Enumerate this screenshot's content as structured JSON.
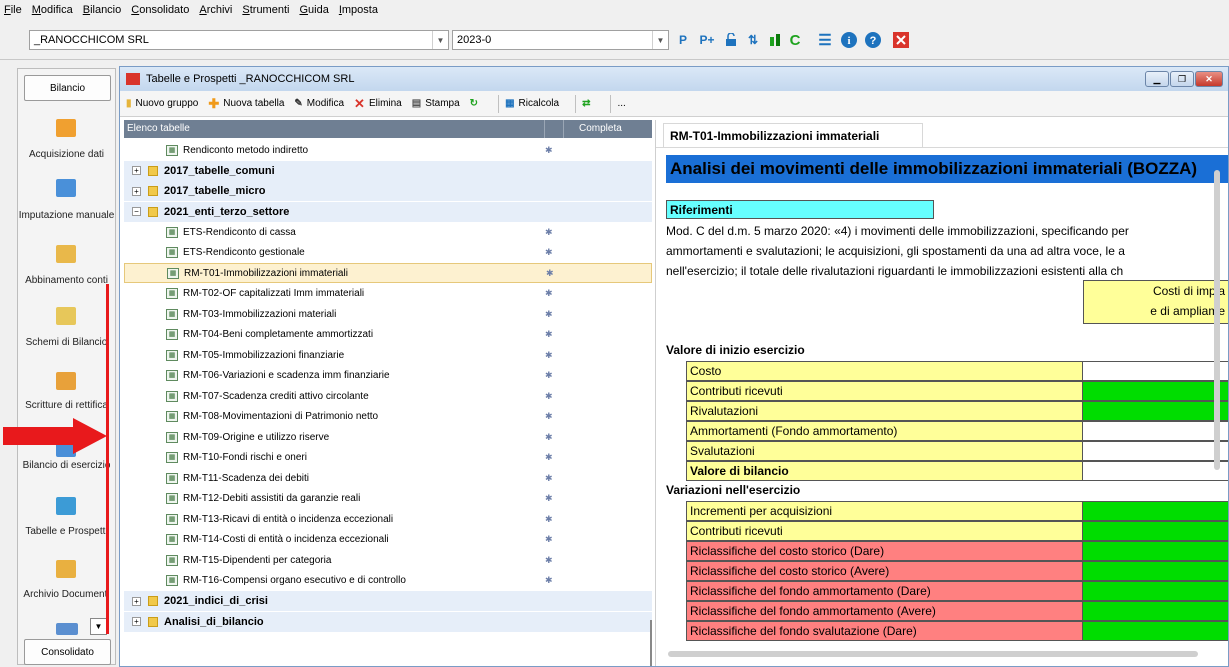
{
  "menu": [
    "File",
    "Modifica",
    "Bilancio",
    "Consolidato",
    "Archivi",
    "Strumenti",
    "Guida",
    "Imposta"
  ],
  "company_combo": "_RANOCCHICOM SRL",
  "period_combo": "2023-0",
  "sidebar": {
    "top_button": "Bilancio",
    "bottom_button": "Consolidato",
    "items": [
      {
        "label": "Acquisizione dati",
        "icon": "download-icon"
      },
      {
        "label": "Imputazione manuale",
        "icon": "edit-form-icon"
      },
      {
        "label": "Abbinamento conti",
        "icon": "link-accounts-icon"
      },
      {
        "label": "Schemi di Bilancio",
        "icon": "schema-icon"
      },
      {
        "label": "Scritture di rettifica",
        "icon": "pen-icon"
      },
      {
        "label": "Bilancio di esercizio",
        "icon": "chart-icon"
      },
      {
        "label": "Tabelle e Prospetti",
        "icon": "tables-icon"
      },
      {
        "label": "Archivio Documenti",
        "icon": "archive-icon"
      }
    ]
  },
  "window": {
    "title": "Tabelle e Prospetti _RANOCCHICOM SRL",
    "toolbar": {
      "new_group": "Nuovo gruppo",
      "new_table": "Nuova tabella",
      "edit": "Modifica",
      "delete": "Elimina",
      "print": "Stampa",
      "recalc": "Ricalcola",
      "more": "..."
    }
  },
  "tree": {
    "col_name": "Elenco tabelle",
    "col_complete": "Completa",
    "rows": [
      {
        "label": "Rendiconto metodo indiretto",
        "type": "doc",
        "gear": true
      },
      {
        "label": "2017_tabelle_comuni",
        "type": "group",
        "exp": "+"
      },
      {
        "label": "2017_tabelle_micro",
        "type": "group",
        "exp": "+"
      },
      {
        "label": "2021_enti_terzo_settore",
        "type": "group",
        "exp": "−"
      },
      {
        "label": "ETS-Rendiconto di cassa",
        "type": "doc",
        "gear": true
      },
      {
        "label": "ETS-Rendiconto gestionale",
        "type": "doc",
        "gear": true
      },
      {
        "label": "RM-T01-Immobilizzazioni immateriali",
        "type": "doc",
        "gear": true,
        "selected": true
      },
      {
        "label": "RM-T02-OF capitalizzati Imm immateriali",
        "type": "doc",
        "gear": true
      },
      {
        "label": "RM-T03-Immobilizzazioni materiali",
        "type": "doc",
        "gear": true
      },
      {
        "label": "RM-T04-Beni completamente ammortizzati",
        "type": "doc",
        "gear": true
      },
      {
        "label": "RM-T05-Immobilizzazioni finanziarie",
        "type": "doc",
        "gear": true
      },
      {
        "label": "RM-T06-Variazioni e scadenza imm finanziarie",
        "type": "doc",
        "gear": true
      },
      {
        "label": "RM-T07-Scadenza crediti attivo circolante",
        "type": "doc",
        "gear": true
      },
      {
        "label": "RM-T08-Movimentazioni di Patrimonio netto",
        "type": "doc",
        "gear": true
      },
      {
        "label": "RM-T09-Origine e utilizzo riserve",
        "type": "doc",
        "gear": true
      },
      {
        "label": "RM-T10-Fondi rischi e oneri",
        "type": "doc",
        "gear": true
      },
      {
        "label": "RM-T11-Scadenza dei debiti",
        "type": "doc",
        "gear": true
      },
      {
        "label": "RM-T12-Debiti assistiti da garanzie reali",
        "type": "doc",
        "gear": true
      },
      {
        "label": "RM-T13-Ricavi di entità o incidenza eccezionali",
        "type": "doc",
        "gear": true
      },
      {
        "label": "RM-T14-Costi di entità o incidenza eccezionali",
        "type": "doc",
        "gear": true
      },
      {
        "label": "RM-T15-Dipendenti per categoria",
        "type": "doc",
        "gear": true
      },
      {
        "label": "RM-T16-Compensi organo esecutivo e di controllo",
        "type": "doc",
        "gear": true
      },
      {
        "label": "2021_indici_di_crisi",
        "type": "group",
        "exp": "+"
      },
      {
        "label": "Analisi_di_bilancio",
        "type": "group",
        "exp": "+"
      }
    ]
  },
  "preview": {
    "tab": "RM-T01-Immobilizzazioni immateriali",
    "heading": "Analisi dei movimenti delle immobilizzazioni immateriali (BOZZA)",
    "riferimenti": "Riferimenti",
    "text_lines": [
      "Mod. C del d.m. 5 marzo 2020: «4) i movimenti delle immobilizzazioni, specificando per",
      "ammortamenti e svalutazioni; le acquisizioni, gli spostamenti da una ad altra voce, le a",
      "nell'esercizio; il totale delle rivalutazioni riguardanti le immobilizzazioni esistenti alla ch"
    ],
    "col_header_lines": [
      "Costi di impia",
      "e di ampliame"
    ],
    "section1": "Valore di inizio esercizio",
    "section2": "Variazioni nell'esercizio",
    "rows1": [
      {
        "label": "Costo",
        "color": "#ffff99",
        "value_color": "#ffffff",
        "bold": false
      },
      {
        "label": "Contributi ricevuti",
        "color": "#ffff99",
        "value_color": "#00dd00",
        "bold": false
      },
      {
        "label": "Rivalutazioni",
        "color": "#ffff99",
        "value_color": "#00dd00",
        "bold": false
      },
      {
        "label": "Ammortamenti (Fondo ammortamento)",
        "color": "#ffff99",
        "value_color": "#ffffff",
        "bold": false
      },
      {
        "label": "Svalutazioni",
        "color": "#ffff99",
        "value_color": "#ffffff",
        "bold": false
      },
      {
        "label": "Valore di bilancio",
        "color": "#ffff99",
        "value_color": "#ffffff",
        "bold": true
      }
    ],
    "rows2": [
      {
        "label": "Incrementi per acquisizioni",
        "color": "#ffff99",
        "value_color": "#00dd00"
      },
      {
        "label": "Contributi ricevuti",
        "color": "#ffff99",
        "value_color": "#00dd00"
      },
      {
        "label": "Riclassifiche del costo storico (Dare)",
        "color": "#ff8080",
        "value_color": "#00dd00"
      },
      {
        "label": "Riclassifiche del costo storico (Avere)",
        "color": "#ff8080",
        "value_color": "#00dd00"
      },
      {
        "label": "Riclassifiche del fondo ammortamento (Dare)",
        "color": "#ff8080",
        "value_color": "#00dd00"
      },
      {
        "label": "Riclassifiche del fondo ammortamento (Avere)",
        "color": "#ff8080",
        "value_color": "#00dd00"
      },
      {
        "label": "Riclassifiche del fondo svalutazione (Dare)",
        "color": "#ff8080",
        "value_color": "#00dd00"
      }
    ]
  },
  "colors": {
    "accent": "#1e73be",
    "heading_bg": "#1a6fd6",
    "riferimenti_bg": "#66ffff",
    "annotation": "#e8191c"
  }
}
